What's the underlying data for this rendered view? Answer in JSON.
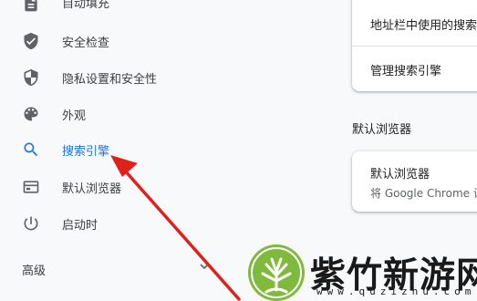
{
  "sidebar": {
    "items": [
      {
        "label": "自动填充",
        "icon": "autofill-icon"
      },
      {
        "label": "安全检查",
        "icon": "shield-check-icon"
      },
      {
        "label": "隐私设置和安全性",
        "icon": "privacy-shield-icon"
      },
      {
        "label": "外观",
        "icon": "palette-icon"
      },
      {
        "label": "搜索引擎",
        "icon": "search-icon",
        "active": true
      },
      {
        "label": "默认浏览器",
        "icon": "browser-window-icon"
      },
      {
        "label": "启动时",
        "icon": "power-icon"
      }
    ],
    "advanced_label": "高级"
  },
  "content": {
    "search_card": {
      "row1": "地址栏中使用的搜索",
      "row2": "管理搜索引擎"
    },
    "default_browser_section": {
      "title": "默认浏览器",
      "card_title": "默认浏览器",
      "card_subtitle": "将 Google Chrome 设"
    }
  },
  "watermark": {
    "title": "紫竹新游网",
    "url": "www.quzizhu.com"
  },
  "colors": {
    "accent": "#1a73e8",
    "icon": "#5f6368",
    "arrow": "#e0201b",
    "watermark_green": "#7fba3c"
  }
}
